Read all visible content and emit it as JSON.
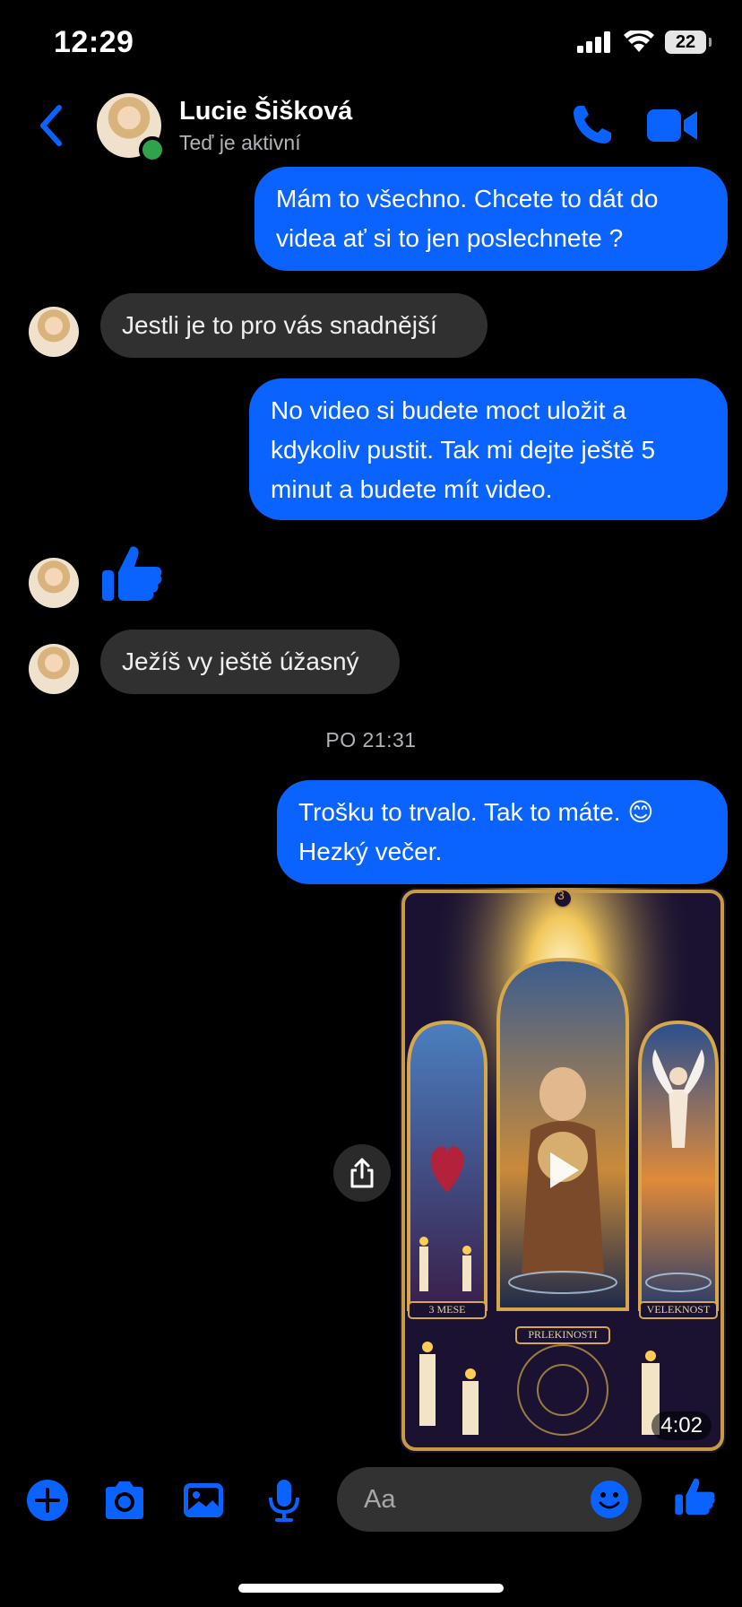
{
  "status_bar": {
    "time": "12:29",
    "battery": "22"
  },
  "header": {
    "contact_name": "Lucie Šišková",
    "presence": "Teď je aktivní"
  },
  "messages": [
    {
      "text": "Mám to všechno. Chcete to dát do videa ať si to jen poslechnete ?"
    },
    {
      "text": "Jestli je to pro vás snadnější"
    },
    {
      "text": "No video si budete moct uložit a kdykoliv pustit. Tak mi dejte ještě 5 minut a budete mít video."
    },
    {
      "text": "Ježíš vy ještě úžasný"
    },
    {
      "text": "Trošku to trvalo. Tak to máte. 😊 Hezký večer."
    }
  ],
  "timestamp": "PO 21:31",
  "video": {
    "duration": "4:02",
    "card_labels": [
      "3 MESE",
      "PRLEKINOSTI",
      "VELEKNOST"
    ],
    "card_number": "3"
  },
  "composer": {
    "placeholder": "Aa"
  },
  "colors": {
    "accent": "#0a62ff",
    "incoming": "#303030",
    "online": "#31a24c"
  }
}
